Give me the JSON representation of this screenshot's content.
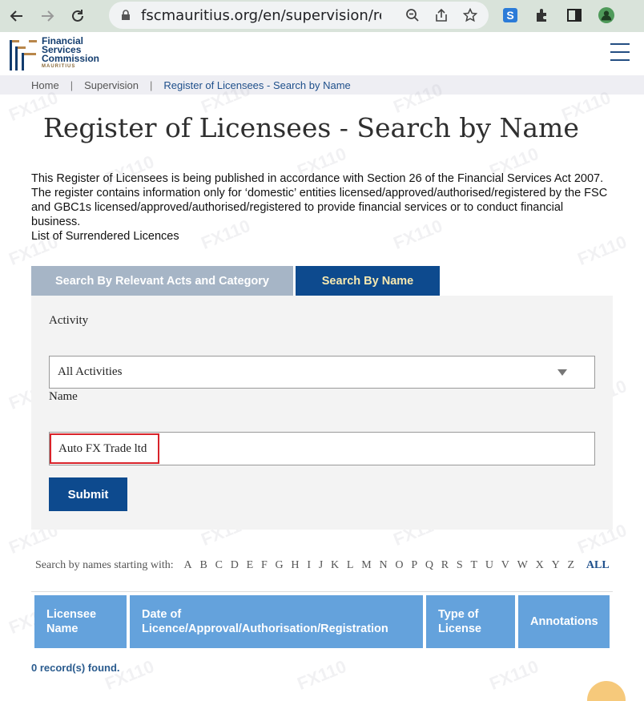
{
  "browser": {
    "url": "fscmauritius.org/en/supervision/re..."
  },
  "logo": {
    "line1": "Financial",
    "line2": "Services",
    "line3": "Commission",
    "line4": "MAURITIUS"
  },
  "breadcrumb": {
    "home": "Home",
    "separator": "|",
    "supervision": "Supervision",
    "current": "Register of Licensees - Search by Name"
  },
  "page": {
    "title": "Register of Licensees - Search by Name",
    "intro": "This Register of Licensees is being published in accordance with Section 26 of the Financial Services Act 2007. The register contains information only for ‘domestic’ entities licensed/approved/authorised/registered by the FSC and GBC1s licensed/approved/authorised/registered to provide financial services or to conduct financial business.",
    "surrendered_link": "List of Surrendered Licences"
  },
  "tabs": {
    "acts": "Search By Relevant Acts and Category",
    "name": "Search By Name"
  },
  "form": {
    "activity_label": "Activity",
    "activity_value": "All Activities",
    "name_label": "Name",
    "name_value": "Auto FX Trade ltd",
    "submit_label": "Submit"
  },
  "alpha_nav": {
    "label": "Search by names starting with:",
    "letters": [
      "A",
      "B",
      "C",
      "D",
      "E",
      "F",
      "G",
      "H",
      "I",
      "J",
      "K",
      "L",
      "M",
      "N",
      "O",
      "P",
      "Q",
      "R",
      "S",
      "T",
      "U",
      "V",
      "W",
      "X",
      "Y",
      "Z"
    ],
    "all": "ALL"
  },
  "table": {
    "columns": [
      "Licensee Name",
      "Date of Licence/Approval/Authorisation/Registration",
      "Type of License",
      "Annotations"
    ]
  },
  "results": {
    "count_text": "0 record(s) found."
  },
  "colors": {
    "brand_blue": "#0d4a8e",
    "tab_inactive": "#a6b5c6",
    "table_header": "#64a2dc",
    "highlight": "#d8232a"
  }
}
